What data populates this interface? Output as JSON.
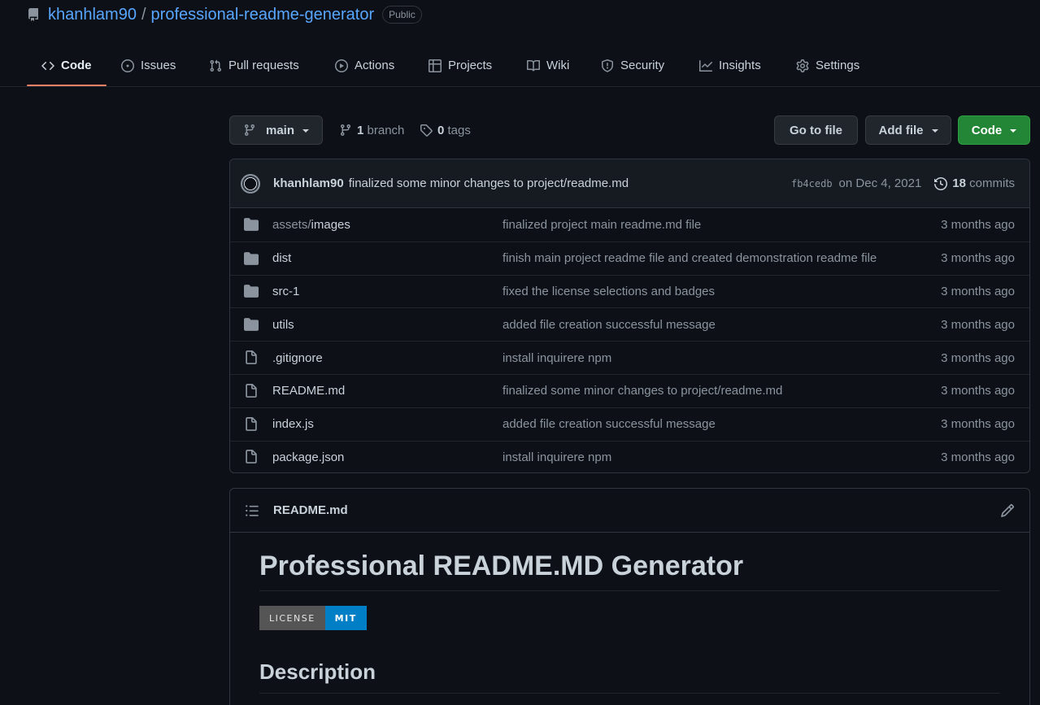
{
  "repo": {
    "owner": "khanhlam90",
    "separator": "/",
    "name": "professional-readme-generator",
    "visibility": "Public"
  },
  "tabs": [
    {
      "label": "Code",
      "icon": "code-icon",
      "active": true
    },
    {
      "label": "Issues",
      "icon": "issue-icon"
    },
    {
      "label": "Pull requests",
      "icon": "pull-request-icon"
    },
    {
      "label": "Actions",
      "icon": "play-icon"
    },
    {
      "label": "Projects",
      "icon": "table-icon"
    },
    {
      "label": "Wiki",
      "icon": "book-icon"
    },
    {
      "label": "Security",
      "icon": "shield-icon"
    },
    {
      "label": "Insights",
      "icon": "graph-icon"
    },
    {
      "label": "Settings",
      "icon": "gear-icon"
    }
  ],
  "toolbar": {
    "branch_select": "main",
    "branch_count": "1",
    "branch_word": "branch",
    "tag_count": "0",
    "tag_word": "tags",
    "go_to_file": "Go to file",
    "add_file": "Add file",
    "code": "Code"
  },
  "latest_commit": {
    "author": "khanhlam90",
    "message": "finalized some minor changes to project/readme.md",
    "sha": "fb4cedb",
    "date": "on Dec 4, 2021",
    "commit_count": "18",
    "commit_word": "commits"
  },
  "files": [
    {
      "prefix": "assets/",
      "name": "images",
      "type": "folder",
      "message": "finalized project main readme.md file",
      "age": "3 months ago"
    },
    {
      "prefix": "",
      "name": "dist",
      "type": "folder",
      "message": "finish main project readme file and created demonstration readme file",
      "age": "3 months ago"
    },
    {
      "prefix": "",
      "name": "src-1",
      "type": "folder",
      "message": "fixed the license selections and badges",
      "age": "3 months ago"
    },
    {
      "prefix": "",
      "name": "utils",
      "type": "folder",
      "message": "added file creation successful message",
      "age": "3 months ago"
    },
    {
      "prefix": "",
      "name": ".gitignore",
      "type": "file",
      "message": "install inquirere npm",
      "age": "3 months ago"
    },
    {
      "prefix": "",
      "name": "README.md",
      "type": "file",
      "message": "finalized some minor changes to project/readme.md",
      "age": "3 months ago"
    },
    {
      "prefix": "",
      "name": "index.js",
      "type": "file",
      "message": "added file creation successful message",
      "age": "3 months ago"
    },
    {
      "prefix": "",
      "name": "package.json",
      "type": "file",
      "message": "install inquirere npm",
      "age": "3 months ago"
    }
  ],
  "readme": {
    "header_title": "README.md",
    "h1": "Professional README.MD Generator",
    "badge_label": "LICENSE",
    "badge_value": "MIT",
    "h2": "Description"
  },
  "colors": {
    "background": "#0d1117",
    "link": "#58a6ff",
    "green_button": "#238636",
    "active_tab_underline": "#f78166",
    "badge_blue": "#007ec6"
  }
}
